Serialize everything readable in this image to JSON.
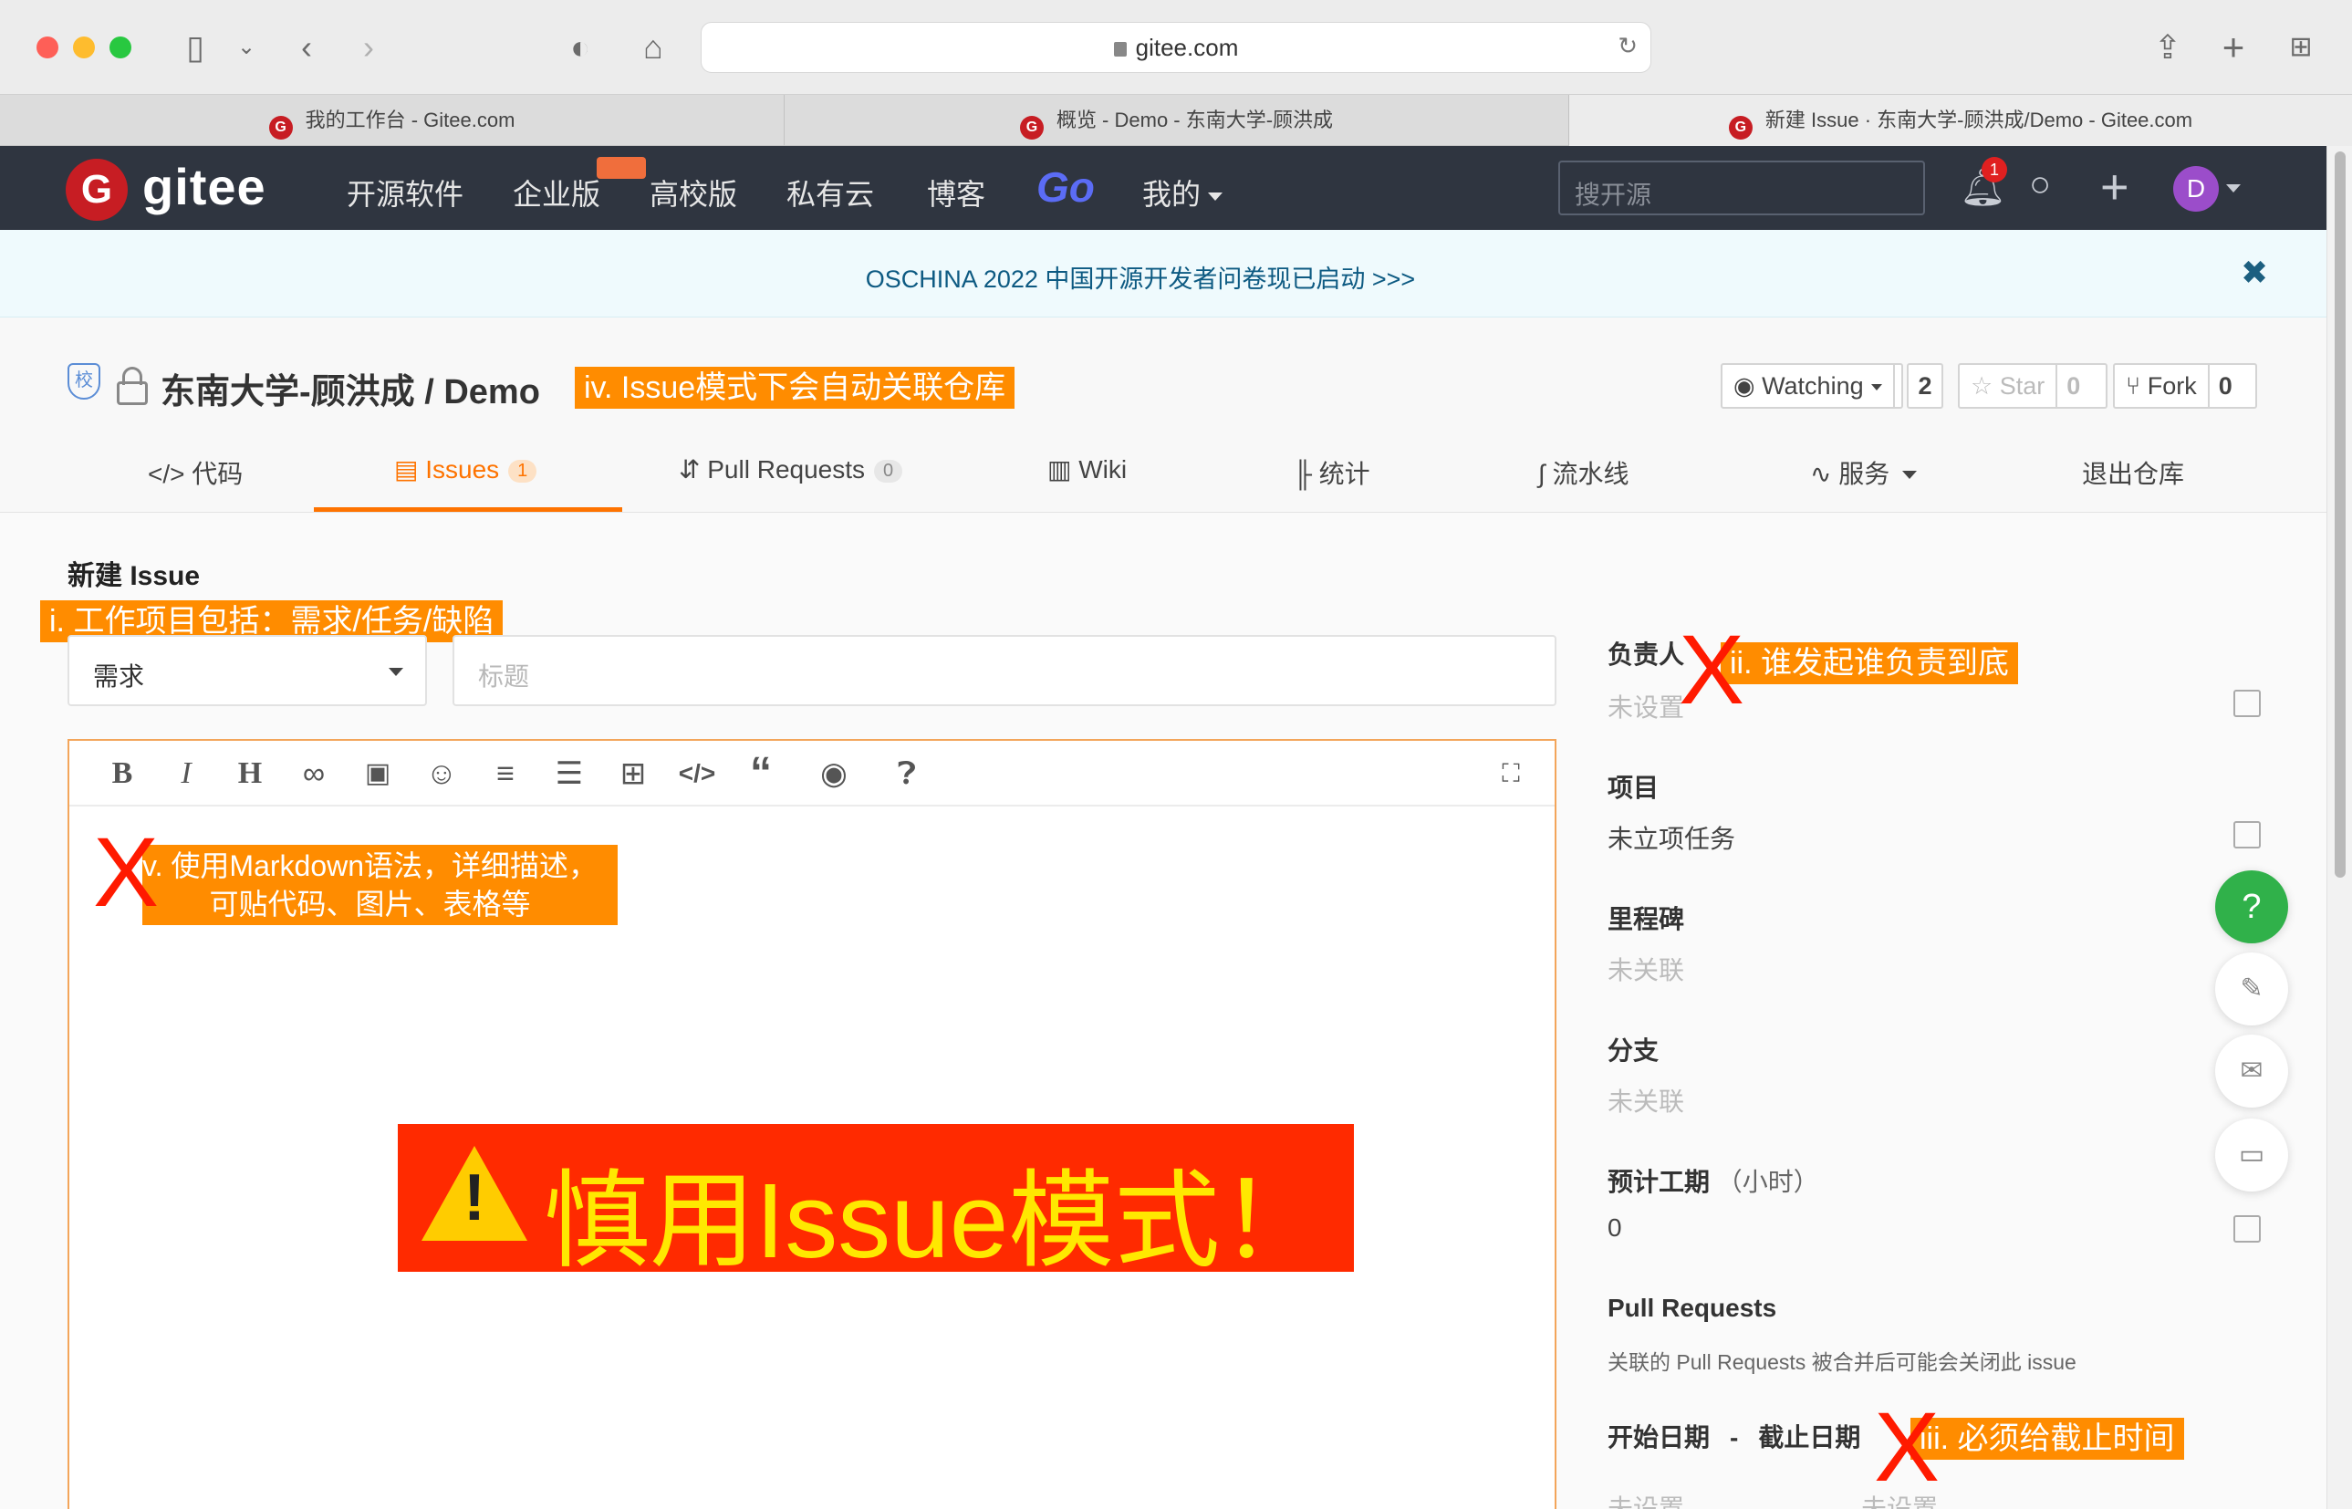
{
  "browser": {
    "url": "gitee.com",
    "tabs": [
      {
        "title": "我的工作台 - Gitee.com",
        "active": false
      },
      {
        "title": "概览 - Demo - 东南大学-顾洪成",
        "active": false
      },
      {
        "title": "新建 Issue · 东南大学-顾洪成/Demo - Gitee.com",
        "active": true
      }
    ]
  },
  "gitee_nav": {
    "logo_text": "gitee",
    "items": [
      "开源软件",
      "企业版",
      "高校版",
      "私有云",
      "博客",
      "Go",
      "我的"
    ],
    "search_placeholder": "搜开源",
    "notification_count": "1",
    "avatar_letter": "D"
  },
  "announcement": {
    "text": "OSCHINA 2022 中国开源开发者问卷现已启动 >>>",
    "close": "✖"
  },
  "repo": {
    "school_badge": "校",
    "title": "东南大学-顾洪成 / Demo",
    "watch_label": "Watching",
    "watch_count": "2",
    "star_label": "Star",
    "star_count": "0",
    "fork_label": "Fork",
    "fork_count": "0",
    "tabs": [
      {
        "label": "代码",
        "icon": "</>"
      },
      {
        "label": "Issues",
        "count": "1",
        "active": true
      },
      {
        "label": "Pull Requests",
        "count": "0"
      },
      {
        "label": "Wiki"
      },
      {
        "label": "统计"
      },
      {
        "label": "流水线"
      },
      {
        "label": "服务"
      },
      {
        "label": "退出仓库"
      }
    ]
  },
  "new_issue": {
    "heading": "新建 Issue",
    "type_selected": "需求",
    "title_placeholder": "标题"
  },
  "sidebar": {
    "assignee_label": "负责人",
    "assignee_value": "未设置",
    "project_label": "项目",
    "project_value": "未立项任务",
    "milestone_label": "里程碑",
    "milestone_value": "未关联",
    "branch_label": "分支",
    "branch_value": "未关联",
    "estimate_label": "预计工期",
    "estimate_unit": "（小时）",
    "estimate_value": "0",
    "pr_label": "Pull Requests",
    "pr_desc": "关联的 Pull Requests 被合并后可能会关闭此 issue",
    "start_label": "开始日期",
    "date_sep": "-",
    "due_label": "截止日期",
    "start_value": "未设置",
    "due_value": "未设置"
  },
  "annotations": {
    "auto_link": "iv. Issue模式下会自动关联仓库",
    "types": "i. 工作项目包括：需求/任务/缺陷",
    "assignee": "ii. 谁发起谁负责到底",
    "markdown_line1": "v. 使用Markdown语法，详细描述，",
    "markdown_line2": "可贴代码、图片、表格等",
    "due": "iii. 必须给截止时间",
    "warning": "慎用Issue模式！",
    "x_mark": "X",
    "exclamation": "!"
  },
  "colors": {
    "nav_bg": "#2f3540",
    "accent": "#fe7300",
    "annotation": "#ff8c00",
    "warning_bg": "#ff2a00",
    "warning_text": "#ffe800"
  }
}
